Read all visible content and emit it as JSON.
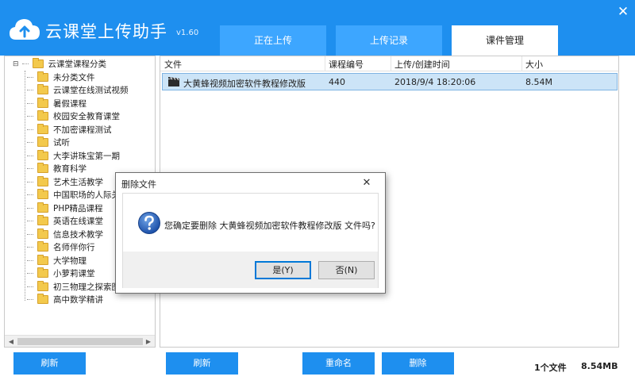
{
  "header": {
    "app_title": "云课堂上传助手",
    "version": "v1.60",
    "close_glyph": "✕",
    "tabs": [
      {
        "label": "正在上传",
        "active": false
      },
      {
        "label": "上传记录",
        "active": false
      },
      {
        "label": "课件管理",
        "active": true
      }
    ],
    "brand_color": "#1e8fef"
  },
  "tree": {
    "root": {
      "label": "云课堂课程分类",
      "expander": "⊟"
    },
    "items": [
      {
        "label": "未分类文件"
      },
      {
        "label": "云课堂在线测试视频"
      },
      {
        "label": "暑假课程"
      },
      {
        "label": "校园安全教育课堂"
      },
      {
        "label": "不加密课程测试"
      },
      {
        "label": "试听"
      },
      {
        "label": "大李讲珠宝第一期"
      },
      {
        "label": "教育科学"
      },
      {
        "label": "艺术生活教学"
      },
      {
        "label": "中国职场的人际关"
      },
      {
        "label": "PHP精品课程"
      },
      {
        "label": "英语在线课堂"
      },
      {
        "label": "信息技术教学"
      },
      {
        "label": "名师伴你行"
      },
      {
        "label": "大学物理"
      },
      {
        "label": "小萝莉课堂"
      },
      {
        "label": "初三物理之探索图"
      },
      {
        "label": "高中数学精讲"
      }
    ]
  },
  "file_list": {
    "columns": {
      "name": "文件",
      "code": "课程编号",
      "time": "上传/创建时间",
      "size": "大小"
    },
    "rows": [
      {
        "name": "大黄蜂视频加密软件教程修改版",
        "code": "440",
        "time": "2018/9/4 18:20:06",
        "size": "8.54M",
        "icon": "video-file-icon",
        "selected": true
      }
    ]
  },
  "buttons": {
    "refresh_left": "刷新",
    "refresh_right": "刷新",
    "rename": "重命名",
    "delete": "删除"
  },
  "status": {
    "file_count": "1个文件",
    "total_size": "8.54MB"
  },
  "dialog": {
    "title": "删除文件",
    "close_glyph": "✕",
    "message": "您确定要删除 大黄蜂视频加密软件教程修改版 文件吗?",
    "icon": "question-icon",
    "yes": "是(Y)",
    "no": "否(N)"
  }
}
